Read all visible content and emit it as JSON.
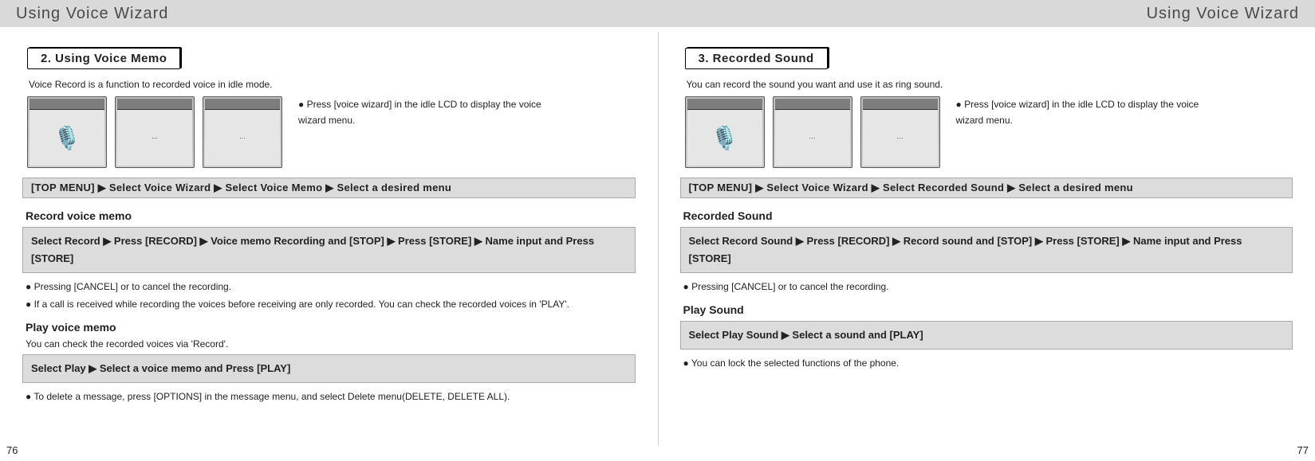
{
  "left": {
    "header": "Using Voice Wizard",
    "section_title": "2. Using Voice Memo",
    "intro": "Voice Record is a function to recorded voice in idle mode.",
    "side_note": "Press [voice wizard] in the idle LCD to display the voice wizard menu.",
    "nav": "[TOP MENU] ▶ Select Voice Wizard ▶ Select Voice Memo ▶ Select a desired menu",
    "sub1_title": "Record voice memo",
    "sub1_instruction": "Select Record ▶ Press [RECORD] ▶ Voice memo Recording and [STOP] ▶ Press [STORE] ▶ Name input and Press [STORE]",
    "sub1_bullets": [
      "Pressing [CANCEL] or  to cancel the recording.",
      "If a call is received while recording the voices before receiving are only recorded. You can check the recorded voices in 'PLAY'."
    ],
    "sub2_title": "Play voice memo",
    "sub2_desc": "You can check the recorded voices via 'Record'.",
    "sub2_instruction": "Select Play ▶  Select a voice memo and Press [PLAY]",
    "sub2_bullet": "To delete a message, press [OPTIONS] in the message menu, and select Delete menu(DELETE, DELETE ALL).",
    "page_number": "76"
  },
  "right": {
    "header": "Using Voice Wizard",
    "section_title": "3. Recorded Sound",
    "intro": "You can record the sound you want and use it as ring sound.",
    "side_note": "Press [voice wizard] in the idle LCD to display the voice wizard menu.",
    "nav": "[TOP MENU] ▶ Select Voice Wizard ▶ Select Recorded Sound ▶ Select a desired menu",
    "sub1_title": "Recorded Sound",
    "sub1_instruction": "Select Record Sound ▶ Press [RECORD] ▶ Record sound and [STOP] ▶ Press [STORE] ▶ Name input and Press [STORE]",
    "sub1_bullet": "Pressing [CANCEL] or  to cancel the recording.",
    "sub2_title": "Play Sound",
    "sub2_instruction": "Select Play Sound ▶  Select a sound and [PLAY]",
    "sub2_bullet": "You can lock the selected functions of the phone.",
    "page_number": "77"
  }
}
